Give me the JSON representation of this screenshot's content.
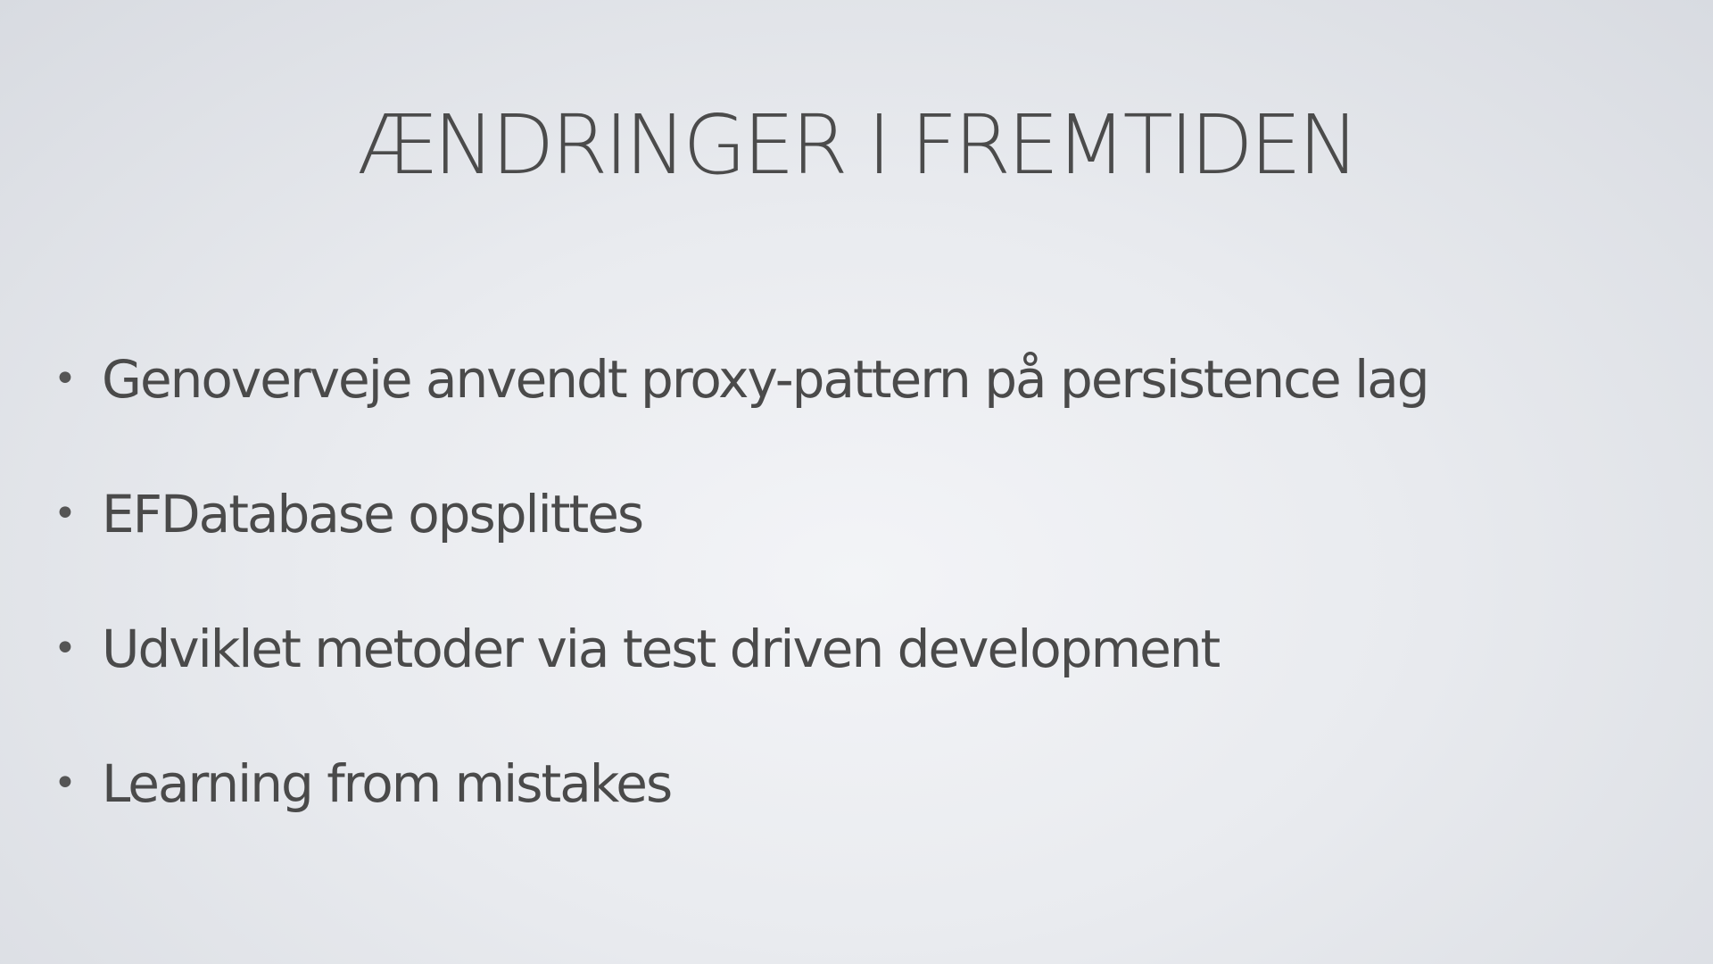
{
  "slide": {
    "title": "ÆNDRINGER I FREMTIDEN",
    "bullet_symbol": "•",
    "bullets": [
      "Genoverveje anvendt proxy-pattern på persistence lag",
      "EFDatabase opsplittes",
      "Udviklet metoder via test driven development",
      "Learning from mistakes"
    ]
  },
  "colors": {
    "text": "#4a4a4a",
    "background_center": "#f3f4f7",
    "background_edge": "#d8dbe1"
  }
}
